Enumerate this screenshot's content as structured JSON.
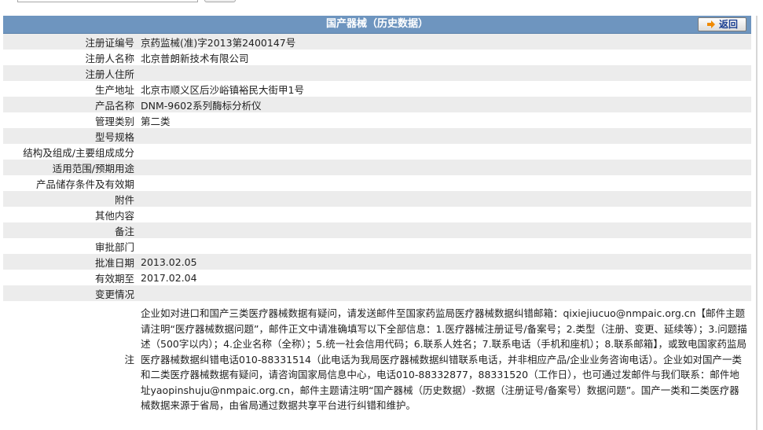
{
  "header": {
    "title": "国产器械（历史数据）",
    "back_label": "返回"
  },
  "rows": [
    {
      "label": "注册证编号",
      "value": "京药监械(准)字2013第2400147号"
    },
    {
      "label": "注册人名称",
      "value": "北京普朗新技术有限公司"
    },
    {
      "label": "注册人住所",
      "value": ""
    },
    {
      "label": "生产地址",
      "value": "北京市顺义区后沙峪镇裕民大街甲1号"
    },
    {
      "label": "产品名称",
      "value": "DNM-9602系列酶标分析仪"
    },
    {
      "label": "管理类别",
      "value": "第二类"
    },
    {
      "label": "型号规格",
      "value": ""
    },
    {
      "label": "结构及组成/主要组成成分",
      "value": ""
    },
    {
      "label": "适用范围/预期用途",
      "value": ""
    },
    {
      "label": "产品储存条件及有效期",
      "value": ""
    },
    {
      "label": "附件",
      "value": ""
    },
    {
      "label": "其他内容",
      "value": ""
    },
    {
      "label": "备注",
      "value": ""
    },
    {
      "label": "审批部门",
      "value": ""
    },
    {
      "label": "批准日期",
      "value": "2013.02.05"
    },
    {
      "label": "有效期至",
      "value": "2017.02.04"
    },
    {
      "label": "变更情况",
      "value": ""
    }
  ],
  "note": {
    "label": "注",
    "text": "企业如对进口和国产三类医疗器械数据有疑问，请发送邮件至国家药监局医疗器械数据纠错邮箱：qixiejiucuo@nmpaic.org.cn【邮件主题请注明“医疗器械数据问题”，邮件正文中请准确填写以下全部信息：1.医疗器械注册证号/备案号；2.类型（注册、变更、延续等）；3.问题描述（500字以内）；4.企业名称（全称）；5.统一社会信用代码；6.联系人姓名；7.联系电话（手机和座机）；8.联系邮箱】，或致电国家药监局医疗器械数据纠错电话010-88331514（此电话为我局医疗器械数据纠错联系电话，并非相应产品/企业业务咨询电话）。企业如对国产一类和二类医疗器械数据有疑问，请咨询国家局信息中心，电话010-88332877，88331520（工作日），也可通过发邮件与我们联系：邮件地址yaopinshuju@nmpaic.org.cn，邮件主题请注明“国产器械（历史数据）-数据（注册证号/备案号）数据问题”。国产一类和二类医疗器械数据来源于省局，由省局通过数据共享平台进行纠错和维护。"
  },
  "colors": {
    "header_bg": "#6e95bf",
    "row_alt": "#ececec",
    "back_text": "#1b3f93",
    "arrow": "#f08a00"
  },
  "icons": {
    "back": "arrow-right-icon"
  }
}
